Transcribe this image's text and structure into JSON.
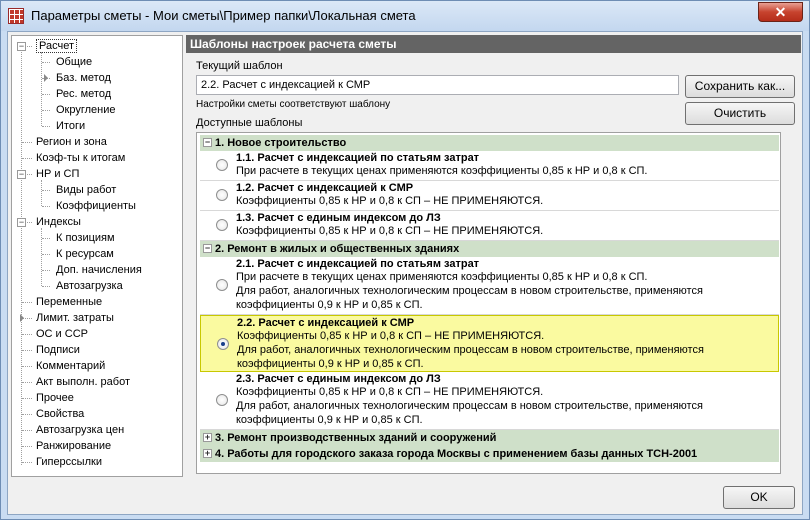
{
  "window": {
    "title": "Параметры сметы - Мои сметы\\Пример папки\\Локальная смета",
    "close": "✕"
  },
  "tree": [
    {
      "label": "Расчет",
      "level": 0,
      "toggle": "−",
      "selected": true
    },
    {
      "label": "Общие",
      "level": 1
    },
    {
      "label": "Баз. метод",
      "level": 1,
      "arrow": true
    },
    {
      "label": "Рес. метод",
      "level": 1
    },
    {
      "label": "Округление",
      "level": 1
    },
    {
      "label": "Итоги",
      "level": 1
    },
    {
      "label": "Регион и зона",
      "level": 0
    },
    {
      "label": "Коэф-ты к итогам",
      "level": 0
    },
    {
      "label": "НР и СП",
      "level": 0,
      "toggle": "−"
    },
    {
      "label": "Виды работ",
      "level": 1
    },
    {
      "label": "Коэффициенты",
      "level": 1
    },
    {
      "label": "Индексы",
      "level": 0,
      "toggle": "−"
    },
    {
      "label": "К позициям",
      "level": 1
    },
    {
      "label": "К ресурсам",
      "level": 1
    },
    {
      "label": "Доп. начисления",
      "level": 1
    },
    {
      "label": "Автозагрузка",
      "level": 1
    },
    {
      "label": "Переменные",
      "level": 0
    },
    {
      "label": "Лимит. затраты",
      "level": 0,
      "arrow": true
    },
    {
      "label": "ОС и ССР",
      "level": 0
    },
    {
      "label": "Подписи",
      "level": 0
    },
    {
      "label": "Комментарий",
      "level": 0
    },
    {
      "label": "Акт выполн. работ",
      "level": 0
    },
    {
      "label": "Прочее",
      "level": 0
    },
    {
      "label": "Свойства",
      "level": 0
    },
    {
      "label": "Автозагрузка цен",
      "level": 0
    },
    {
      "label": "Ранжирование",
      "level": 0
    },
    {
      "label": "Гиперссылки",
      "level": 0
    }
  ],
  "panel": {
    "header": "Шаблоны настроек расчета сметы",
    "current_label": "Текущий шаблон",
    "current_value": "2.2. Расчет с индексацией к СМР",
    "status": "Настройки сметы соответствуют шаблону",
    "available_label": "Доступные шаблоны",
    "save_button": "Сохранить как...",
    "clear_button": "Очистить"
  },
  "groups": [
    {
      "label": "1. Новое строительство",
      "toggle": "−"
    },
    {
      "label": "2. Ремонт в жилых и общественных зданиях",
      "toggle": "−"
    },
    {
      "label": "3. Ремонт производственных зданий и сооружений",
      "toggle": "+"
    },
    {
      "label": "4. Работы для городского заказа города Москвы с применением базы данных ТСН-2001",
      "toggle": "+"
    }
  ],
  "items": [
    {
      "title": "1.1. Расчет с индексацией по статьям затрат",
      "lines": [
        "При расчете в текущих ценах применяются коэффициенты 0,85 к НР и 0,8 к СП."
      ]
    },
    {
      "title": "1.2. Расчет с индексацией к СМР",
      "lines": [
        "Коэффициенты 0,85 к НР и 0,8 к СП – НЕ ПРИМЕНЯЮТСЯ."
      ]
    },
    {
      "title": "1.3. Расчет с единым индексом до ЛЗ",
      "lines": [
        "Коэффициенты 0,85 к НР и 0,8 к СП – НЕ ПРИМЕНЯЮТСЯ."
      ]
    },
    {
      "title": "2.1. Расчет с индексацией по статьям затрат",
      "lines": [
        "При расчете в текущих ценах применяются коэффициенты 0,85 к НР и 0,8 к СП.",
        "Для работ, аналогичных технологическим процессам в новом строительстве, применяются",
        "коэффициенты 0,9 к НР и 0,85 к СП."
      ]
    },
    {
      "title": "2.2. Расчет с индексацией к СМР",
      "lines": [
        "Коэффициенты 0,85 к НР и 0,8 к СП – НЕ ПРИМЕНЯЮТСЯ.",
        "Для работ, аналогичных технологическим процессам в новом строительстве, применяются",
        "коэффициенты 0,9 к НР и 0,85 к СП."
      ],
      "selected": true
    },
    {
      "title": "2.3. Расчет с единым индексом до ЛЗ",
      "lines": [
        "Коэффициенты 0,85 к НР и 0,8 к СП – НЕ ПРИМЕНЯЮТСЯ.",
        "Для работ, аналогичных технологическим процессам в новом строительстве, применяются",
        "коэффициенты 0,9 к НР и 0,85 к СП."
      ]
    }
  ],
  "footer": {
    "ok_button": "OK"
  }
}
